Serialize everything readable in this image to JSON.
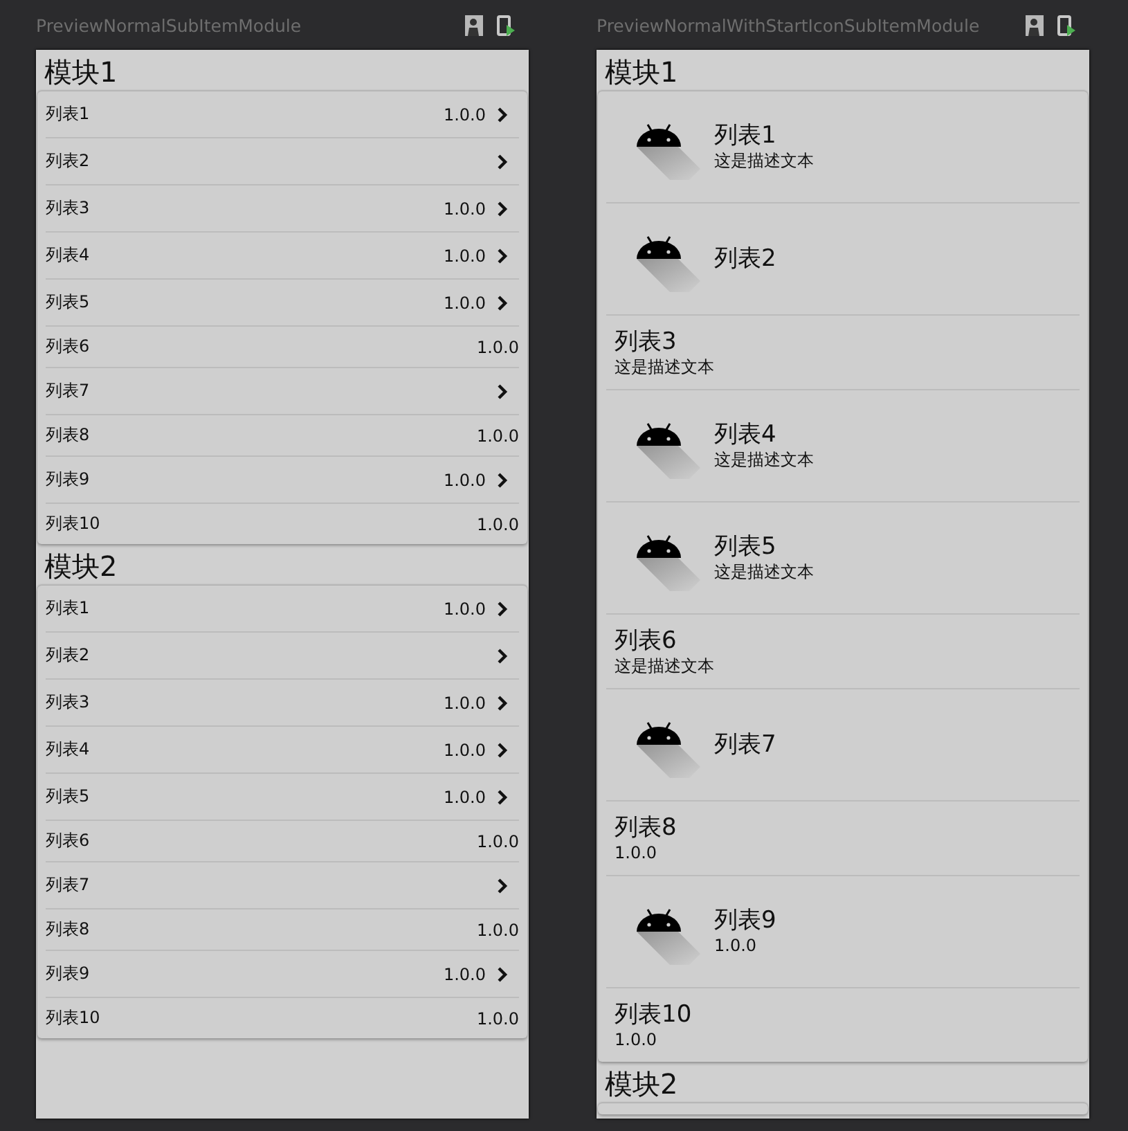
{
  "previews": [
    {
      "kind": "value-list",
      "title": "PreviewNormalSubItemModule",
      "modules": [
        {
          "title": "模块1",
          "items": [
            {
              "label": "列表1",
              "value": "1.0.0",
              "arrow": true
            },
            {
              "label": "列表2",
              "arrow": true
            },
            {
              "label": "列表3",
              "value": "1.0.0",
              "arrow": true
            },
            {
              "label": "列表4",
              "value": "1.0.0",
              "arrow": true
            },
            {
              "label": "列表5",
              "value": "1.0.0",
              "arrow": true
            },
            {
              "label": "列表6",
              "value": "1.0.0",
              "arrow": false
            },
            {
              "label": "列表7",
              "arrow": true
            },
            {
              "label": "列表8",
              "value": "1.0.0",
              "arrow": false
            },
            {
              "label": "列表9",
              "value": "1.0.0",
              "arrow": true
            },
            {
              "label": "列表10",
              "value": "1.0.0",
              "arrow": false
            }
          ]
        },
        {
          "title": "模块2",
          "items": [
            {
              "label": "列表1",
              "value": "1.0.0",
              "arrow": true
            },
            {
              "label": "列表2",
              "arrow": true
            },
            {
              "label": "列表3",
              "value": "1.0.0",
              "arrow": true
            },
            {
              "label": "列表4",
              "value": "1.0.0",
              "arrow": true
            },
            {
              "label": "列表5",
              "value": "1.0.0",
              "arrow": true
            },
            {
              "label": "列表6",
              "value": "1.0.0",
              "arrow": false
            },
            {
              "label": "列表7",
              "arrow": true
            },
            {
              "label": "列表8",
              "value": "1.0.0",
              "arrow": false
            },
            {
              "label": "列表9",
              "value": "1.0.0",
              "arrow": true
            },
            {
              "label": "列表10",
              "value": "1.0.0",
              "arrow": false
            }
          ]
        }
      ]
    },
    {
      "kind": "icon-list",
      "title": "PreviewNormalWithStartIconSubItemModule",
      "modules": [
        {
          "title": "模块1",
          "items": [
            {
              "label": "列表1",
              "subtitle": "这是描述文本",
              "icon": true
            },
            {
              "label": "列表2",
              "icon": true
            },
            {
              "label": "列表3",
              "subtitle": "这是描述文本",
              "icon": false
            },
            {
              "label": "列表4",
              "subtitle": "这是描述文本",
              "icon": true
            },
            {
              "label": "列表5",
              "subtitle": "这是描述文本",
              "icon": true
            },
            {
              "label": "列表6",
              "subtitle": "这是描述文本",
              "icon": false
            },
            {
              "label": "列表7",
              "icon": true
            },
            {
              "label": "列表8",
              "subtitle": "1.0.0",
              "icon": false
            },
            {
              "label": "列表9",
              "subtitle": "1.0.0",
              "icon": true
            },
            {
              "label": "列表10",
              "subtitle": "1.0.0",
              "icon": false
            }
          ]
        },
        {
          "title": "模块2"
        }
      ]
    }
  ]
}
